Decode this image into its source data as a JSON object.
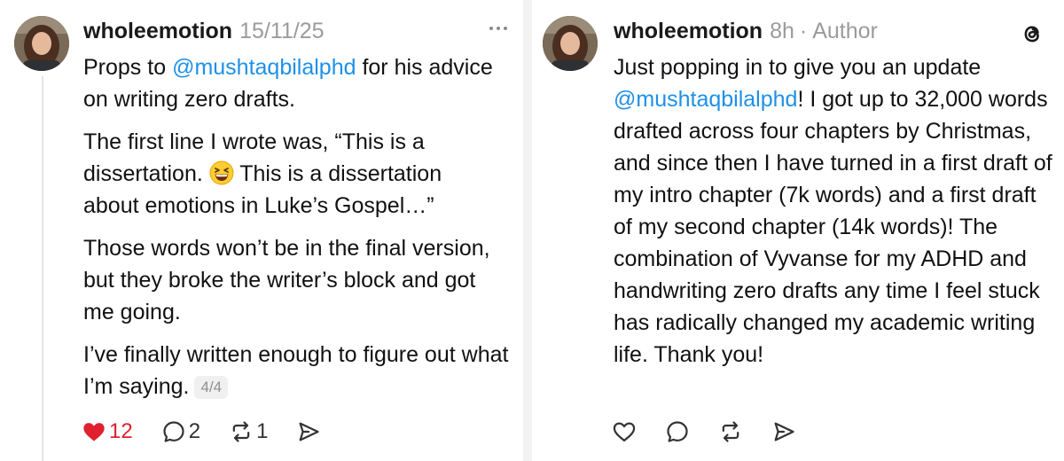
{
  "left_post": {
    "username": "wholeemotion",
    "timestamp": "15/11/25",
    "paragraphs": [
      {
        "before": "Props to ",
        "mention": "@mushtaqbilalphd",
        "after": " for his advice on writing zero drafts."
      },
      {
        "line1": "The first line I wrote was, “This is a",
        "line2a": "dissertation.",
        "line2b": " This is a dissertation",
        "line3": "about emotions in Luke’s Gospel…”"
      },
      {
        "text": "Those words won’t be in the final version, but they broke the writer’s block and got me going."
      },
      {
        "text": "I’ve finally written enough to figure out what I’m saying."
      }
    ],
    "page_indicator": "4/4",
    "actions": {
      "likes": "12",
      "replies": "2",
      "reposts": "1"
    },
    "icons": [
      "more-icon",
      "heart-icon",
      "reply-icon",
      "repost-icon",
      "share-icon",
      "grinning-squinting-face-emoji"
    ]
  },
  "right_post": {
    "username": "wholeemotion",
    "timestamp": "8h",
    "separator": "·",
    "author_label": "Author",
    "text_before": "Just popping in to give you an update ",
    "mention": "@mushtaqbilalphd",
    "text_after": "! I got up to 32,000 words drafted across four chapters by Christmas, and since then I have turned in a first draft of my intro chapter (7k words) and a first draft of my second chapter (14k words)! The combination of Vyvanse for my ADHD and handwriting zero drafts any time I feel stuck has radically changed my academic writing life. Thank you!",
    "icons": [
      "threads-logo-icon",
      "heart-icon",
      "reply-icon",
      "repost-icon",
      "share-icon"
    ]
  },
  "colors": {
    "mention": "#1e90e8",
    "like": "#e0202f",
    "meta": "#9b9b9b"
  }
}
